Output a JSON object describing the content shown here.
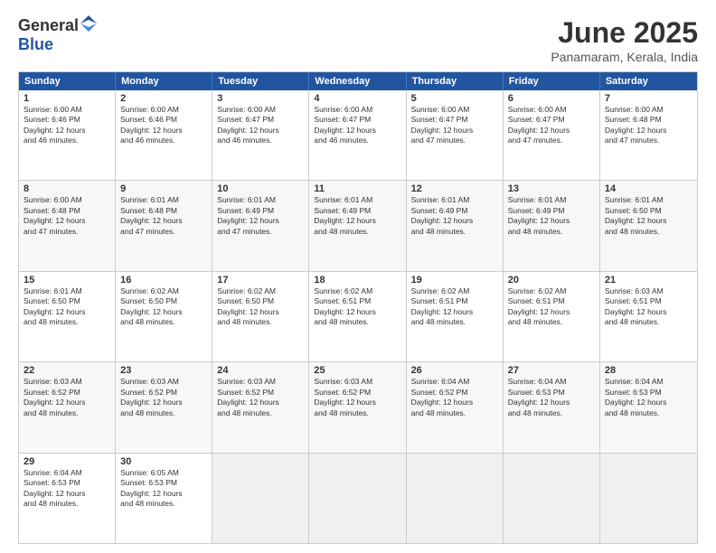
{
  "logo": {
    "general": "General",
    "blue": "Blue"
  },
  "title": "June 2025",
  "location": "Panamaram, Kerala, India",
  "days_of_week": [
    "Sunday",
    "Monday",
    "Tuesday",
    "Wednesday",
    "Thursday",
    "Friday",
    "Saturday"
  ],
  "weeks": [
    [
      {
        "day": "1",
        "lines": [
          "Sunrise: 6:00 AM",
          "Sunset: 6:46 PM",
          "Daylight: 12 hours",
          "and 46 minutes."
        ]
      },
      {
        "day": "2",
        "lines": [
          "Sunrise: 6:00 AM",
          "Sunset: 6:46 PM",
          "Daylight: 12 hours",
          "and 46 minutes."
        ]
      },
      {
        "day": "3",
        "lines": [
          "Sunrise: 6:00 AM",
          "Sunset: 6:47 PM",
          "Daylight: 12 hours",
          "and 46 minutes."
        ]
      },
      {
        "day": "4",
        "lines": [
          "Sunrise: 6:00 AM",
          "Sunset: 6:47 PM",
          "Daylight: 12 hours",
          "and 46 minutes."
        ]
      },
      {
        "day": "5",
        "lines": [
          "Sunrise: 6:00 AM",
          "Sunset: 6:47 PM",
          "Daylight: 12 hours",
          "and 47 minutes."
        ]
      },
      {
        "day": "6",
        "lines": [
          "Sunrise: 6:00 AM",
          "Sunset: 6:47 PM",
          "Daylight: 12 hours",
          "and 47 minutes."
        ]
      },
      {
        "day": "7",
        "lines": [
          "Sunrise: 6:00 AM",
          "Sunset: 6:48 PM",
          "Daylight: 12 hours",
          "and 47 minutes."
        ]
      }
    ],
    [
      {
        "day": "8",
        "lines": [
          "Sunrise: 6:00 AM",
          "Sunset: 6:48 PM",
          "Daylight: 12 hours",
          "and 47 minutes."
        ]
      },
      {
        "day": "9",
        "lines": [
          "Sunrise: 6:01 AM",
          "Sunset: 6:48 PM",
          "Daylight: 12 hours",
          "and 47 minutes."
        ]
      },
      {
        "day": "10",
        "lines": [
          "Sunrise: 6:01 AM",
          "Sunset: 6:49 PM",
          "Daylight: 12 hours",
          "and 47 minutes."
        ]
      },
      {
        "day": "11",
        "lines": [
          "Sunrise: 6:01 AM",
          "Sunset: 6:49 PM",
          "Daylight: 12 hours",
          "and 48 minutes."
        ]
      },
      {
        "day": "12",
        "lines": [
          "Sunrise: 6:01 AM",
          "Sunset: 6:49 PM",
          "Daylight: 12 hours",
          "and 48 minutes."
        ]
      },
      {
        "day": "13",
        "lines": [
          "Sunrise: 6:01 AM",
          "Sunset: 6:49 PM",
          "Daylight: 12 hours",
          "and 48 minutes."
        ]
      },
      {
        "day": "14",
        "lines": [
          "Sunrise: 6:01 AM",
          "Sunset: 6:50 PM",
          "Daylight: 12 hours",
          "and 48 minutes."
        ]
      }
    ],
    [
      {
        "day": "15",
        "lines": [
          "Sunrise: 6:01 AM",
          "Sunset: 6:50 PM",
          "Daylight: 12 hours",
          "and 48 minutes."
        ]
      },
      {
        "day": "16",
        "lines": [
          "Sunrise: 6:02 AM",
          "Sunset: 6:50 PM",
          "Daylight: 12 hours",
          "and 48 minutes."
        ]
      },
      {
        "day": "17",
        "lines": [
          "Sunrise: 6:02 AM",
          "Sunset: 6:50 PM",
          "Daylight: 12 hours",
          "and 48 minutes."
        ]
      },
      {
        "day": "18",
        "lines": [
          "Sunrise: 6:02 AM",
          "Sunset: 6:51 PM",
          "Daylight: 12 hours",
          "and 48 minutes."
        ]
      },
      {
        "day": "19",
        "lines": [
          "Sunrise: 6:02 AM",
          "Sunset: 6:51 PM",
          "Daylight: 12 hours",
          "and 48 minutes."
        ]
      },
      {
        "day": "20",
        "lines": [
          "Sunrise: 6:02 AM",
          "Sunset: 6:51 PM",
          "Daylight: 12 hours",
          "and 48 minutes."
        ]
      },
      {
        "day": "21",
        "lines": [
          "Sunrise: 6:03 AM",
          "Sunset: 6:51 PM",
          "Daylight: 12 hours",
          "and 48 minutes."
        ]
      }
    ],
    [
      {
        "day": "22",
        "lines": [
          "Sunrise: 6:03 AM",
          "Sunset: 6:52 PM",
          "Daylight: 12 hours",
          "and 48 minutes."
        ]
      },
      {
        "day": "23",
        "lines": [
          "Sunrise: 6:03 AM",
          "Sunset: 6:52 PM",
          "Daylight: 12 hours",
          "and 48 minutes."
        ]
      },
      {
        "day": "24",
        "lines": [
          "Sunrise: 6:03 AM",
          "Sunset: 6:52 PM",
          "Daylight: 12 hours",
          "and 48 minutes."
        ]
      },
      {
        "day": "25",
        "lines": [
          "Sunrise: 6:03 AM",
          "Sunset: 6:52 PM",
          "Daylight: 12 hours",
          "and 48 minutes."
        ]
      },
      {
        "day": "26",
        "lines": [
          "Sunrise: 6:04 AM",
          "Sunset: 6:52 PM",
          "Daylight: 12 hours",
          "and 48 minutes."
        ]
      },
      {
        "day": "27",
        "lines": [
          "Sunrise: 6:04 AM",
          "Sunset: 6:53 PM",
          "Daylight: 12 hours",
          "and 48 minutes."
        ]
      },
      {
        "day": "28",
        "lines": [
          "Sunrise: 6:04 AM",
          "Sunset: 6:53 PM",
          "Daylight: 12 hours",
          "and 48 minutes."
        ]
      }
    ],
    [
      {
        "day": "29",
        "lines": [
          "Sunrise: 6:04 AM",
          "Sunset: 6:53 PM",
          "Daylight: 12 hours",
          "and 48 minutes."
        ]
      },
      {
        "day": "30",
        "lines": [
          "Sunrise: 6:05 AM",
          "Sunset: 6:53 PM",
          "Daylight: 12 hours",
          "and 48 minutes."
        ]
      },
      {
        "day": "",
        "lines": []
      },
      {
        "day": "",
        "lines": []
      },
      {
        "day": "",
        "lines": []
      },
      {
        "day": "",
        "lines": []
      },
      {
        "day": "",
        "lines": []
      }
    ]
  ],
  "row_alts": [
    false,
    true,
    false,
    true,
    false
  ]
}
